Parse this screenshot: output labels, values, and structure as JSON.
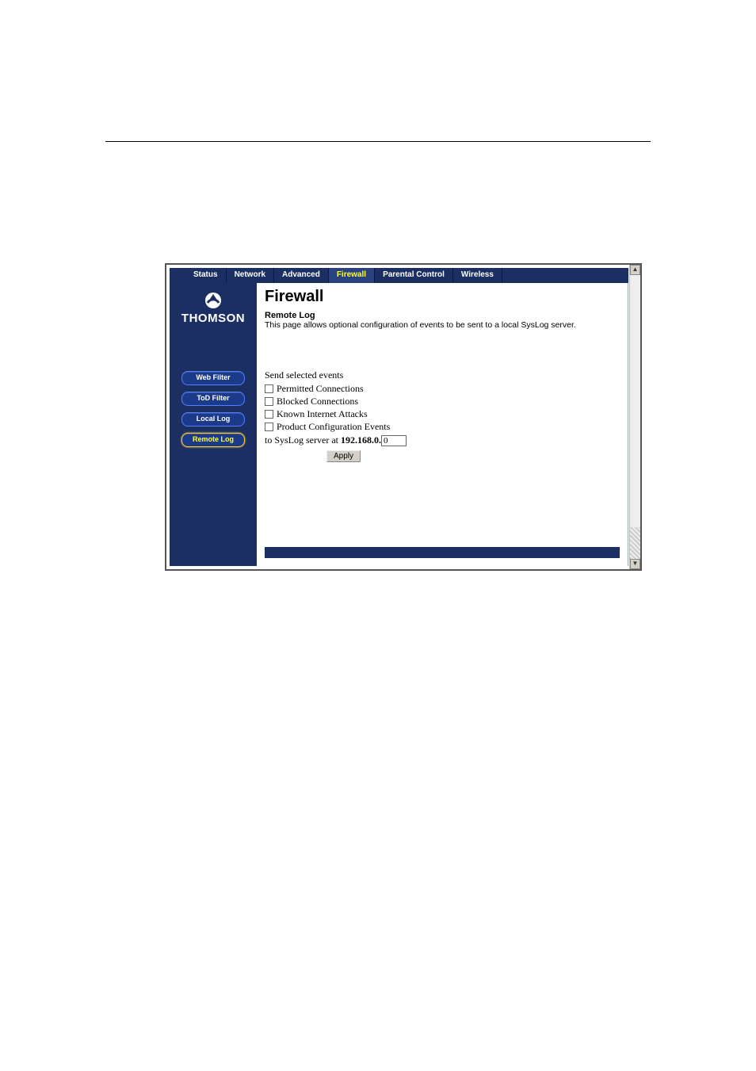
{
  "tabs": [
    {
      "label": "Status"
    },
    {
      "label": "Network"
    },
    {
      "label": "Advanced"
    },
    {
      "label": "Firewall",
      "active": true
    },
    {
      "label": "Parental Control"
    },
    {
      "label": "Wireless"
    }
  ],
  "brand": "THOMSON",
  "sidenav": [
    {
      "label": "Web Filter"
    },
    {
      "label": "ToD Filter"
    },
    {
      "label": "Local Log"
    },
    {
      "label": "Remote Log",
      "active": true
    }
  ],
  "page": {
    "title": "Firewall",
    "subtitle": "Remote Log",
    "description": "This page allows optional configuration of events to be sent to a local SysLog server."
  },
  "form": {
    "lead": "Send selected events",
    "options": [
      {
        "label": "Permitted Connections",
        "checked": false
      },
      {
        "label": "Blocked Connections",
        "checked": false
      },
      {
        "label": "Known Internet Attacks",
        "checked": false
      },
      {
        "label": "Product Configuration Events",
        "checked": false
      }
    ],
    "server_prefix": "to SysLog server at ",
    "server_ip_fixed": "192.168.0.",
    "server_ip_last": "0",
    "apply_label": "Apply"
  }
}
